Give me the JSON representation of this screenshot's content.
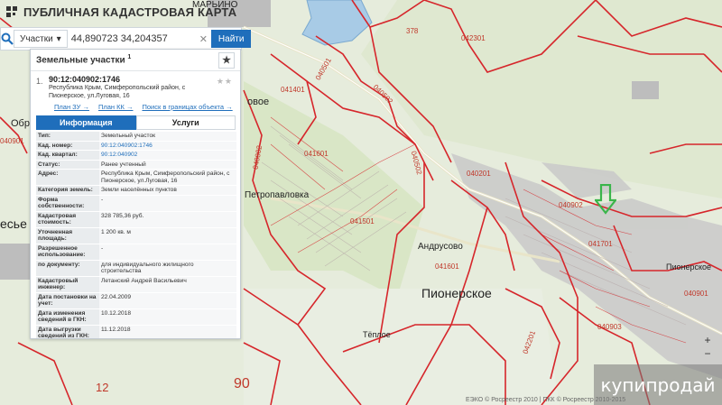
{
  "app": {
    "title": "ПУБЛИЧНАЯ КАДАСТРОВАЯ КАРТА"
  },
  "search": {
    "type_label": "Участки",
    "query": "44,890723 34,204357",
    "button_label": "Найти"
  },
  "panel": {
    "header": "Земельные участки",
    "header_count": "1",
    "result": {
      "index": "1.",
      "cad_number": "90:12:040902:1746",
      "address_line1": "Республика Крым, Симферопольский район, с",
      "address_line2": "Пионерское, ул.Луговая, 16"
    },
    "links": [
      "План ЗУ →",
      "План КК →",
      "Поиск в границах объекта →"
    ],
    "tabs": [
      "Информация",
      "Услуги"
    ],
    "rows": [
      {
        "k": "Тип:",
        "v": "Земельный участок"
      },
      {
        "k": "Кад. номер:",
        "v": "90:12:040902:1746"
      },
      {
        "k": "Кад. квартал:",
        "v": "90:12:040902"
      },
      {
        "k": "Статус:",
        "v": "Ранее учтенный"
      },
      {
        "k": "Адрес:",
        "v": "Республика Крым, Симферопольский район, с Пионерское, ул.Луговая, 16"
      },
      {
        "k": "Категория земель:",
        "v": "Земли населённых пунктов"
      },
      {
        "k": "Форма собственности:",
        "v": "-"
      },
      {
        "k": "Кадастровая стоимость:",
        "v": "328 785,36 руб."
      },
      {
        "k": "Уточненная площадь:",
        "v": "1 200 кв. м"
      },
      {
        "k": "Разрешенное использование:",
        "v": "-"
      },
      {
        "k": "по документу:",
        "v": "для индивидуального жилищного строительства"
      },
      {
        "k": "Кадастровый инженер:",
        "v": "Летанский Андрей Васильевич"
      },
      {
        "k": "Дата постановки на учет:",
        "v": "22.04.2009"
      },
      {
        "k": "Дата изменения сведений в ГКН:",
        "v": "10.12.2018"
      },
      {
        "k": "Дата выгрузки сведений из ГКН:",
        "v": "11.12.2018"
      }
    ]
  },
  "map": {
    "towns": {
      "marino": "МАРЬИНО",
      "petropavlovka": "Петропавловка",
      "andrusovo": "Андрусово",
      "pionerskoe": "Пионерское",
      "pionerskoe_small": "Пионерское",
      "teploe": "Тёплое",
      "obr": "Обр",
      "sye": "есье",
      "ovoe": "овое"
    },
    "parcels": {
      "p042301": "042301",
      "p041401": "041401",
      "p041601": "041601",
      "p040201": "040201",
      "p040902": "040902",
      "p041701": "041701",
      "p041501": "041501",
      "p040901": "040901",
      "p040903": "040903",
      "p042201": "042201",
      "p040502": "040502",
      "p040802": "040802",
      "p040901b": "040901",
      "p040502b": "040502",
      "p040501": "040501",
      "p378": "378"
    },
    "big_numbers": {
      "n12": "12",
      "n90": "90"
    }
  },
  "zoom": {
    "plus": "+",
    "minus": "−"
  },
  "copyright": "ЕЭКО © Росреестр 2010 | ПКК © Росреестр 2010-2015",
  "watermark": "купипродай",
  "colors": {
    "accent": "#1f6ebb",
    "boundary": "#d6262b",
    "arrow": "#3ab54a"
  }
}
